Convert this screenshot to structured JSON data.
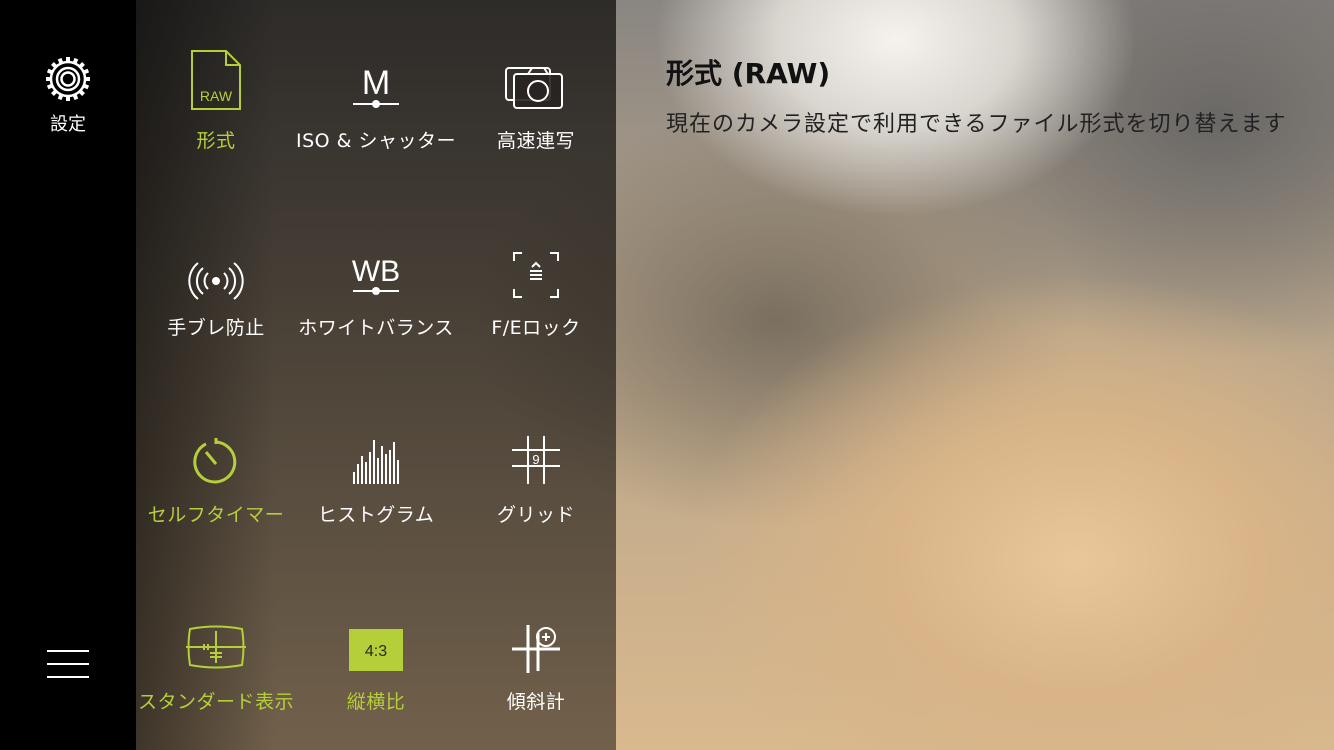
{
  "sidebar": {
    "settings_label": "設定"
  },
  "accent_color": "#b5cf3a",
  "tiles": [
    {
      "label": "形式",
      "icon": "raw-file-icon",
      "active": true,
      "icon_text": "RAW"
    },
    {
      "label": "ISO & シャッター",
      "icon": "manual-iso-icon",
      "active": false,
      "icon_text": "M"
    },
    {
      "label": "高速連写",
      "icon": "burst-camera-icon",
      "active": false
    },
    {
      "label": "手ブレ防止",
      "icon": "stabilizer-icon",
      "active": false
    },
    {
      "label": "ホワイトバランス",
      "icon": "white-balance-icon",
      "active": false,
      "icon_text": "WB"
    },
    {
      "label": "F/Eロック",
      "icon": "focus-exposure-lock-icon",
      "active": false
    },
    {
      "label": "セルフタイマー",
      "icon": "timer-icon",
      "active": true
    },
    {
      "label": "ヒストグラム",
      "icon": "histogram-icon",
      "active": false
    },
    {
      "label": "グリッド",
      "icon": "grid-icon",
      "active": false,
      "icon_text": "9"
    },
    {
      "label": "スタンダード表示",
      "icon": "standard-view-icon",
      "active": true
    },
    {
      "label": "縦横比",
      "icon": "aspect-ratio-icon",
      "active": true,
      "icon_text": "4:3"
    },
    {
      "label": "傾斜計",
      "icon": "inclinometer-icon",
      "active": false
    }
  ],
  "description": {
    "title": "形式 (RAW)",
    "body": "現在のカメラ設定で利用できるファイル形式を切り替えます"
  }
}
